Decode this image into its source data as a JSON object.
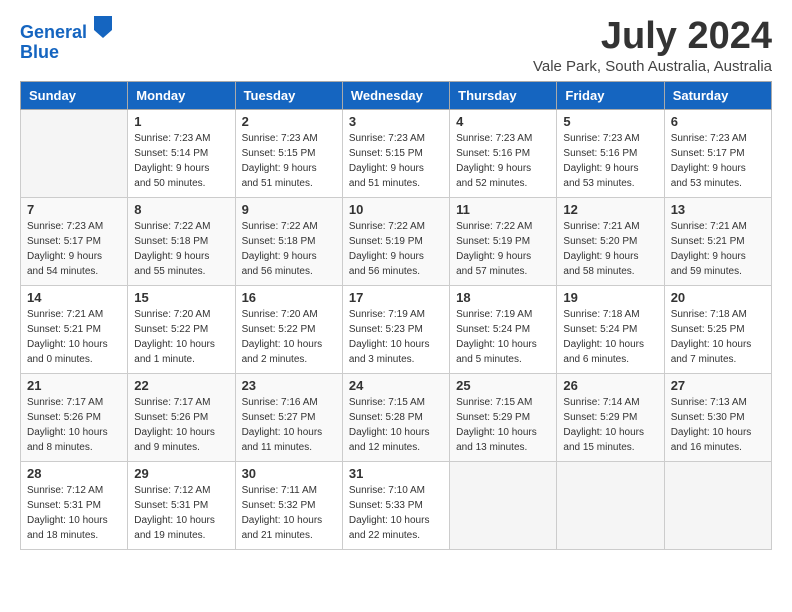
{
  "header": {
    "logo_line1": "General",
    "logo_line2": "Blue",
    "month_title": "July 2024",
    "location": "Vale Park, South Australia, Australia"
  },
  "days_of_week": [
    "Sunday",
    "Monday",
    "Tuesday",
    "Wednesday",
    "Thursday",
    "Friday",
    "Saturday"
  ],
  "weeks": [
    [
      {
        "date": "",
        "info": ""
      },
      {
        "date": "1",
        "info": "Sunrise: 7:23 AM\nSunset: 5:14 PM\nDaylight: 9 hours\nand 50 minutes."
      },
      {
        "date": "2",
        "info": "Sunrise: 7:23 AM\nSunset: 5:15 PM\nDaylight: 9 hours\nand 51 minutes."
      },
      {
        "date": "3",
        "info": "Sunrise: 7:23 AM\nSunset: 5:15 PM\nDaylight: 9 hours\nand 51 minutes."
      },
      {
        "date": "4",
        "info": "Sunrise: 7:23 AM\nSunset: 5:16 PM\nDaylight: 9 hours\nand 52 minutes."
      },
      {
        "date": "5",
        "info": "Sunrise: 7:23 AM\nSunset: 5:16 PM\nDaylight: 9 hours\nand 53 minutes."
      },
      {
        "date": "6",
        "info": "Sunrise: 7:23 AM\nSunset: 5:17 PM\nDaylight: 9 hours\nand 53 minutes."
      }
    ],
    [
      {
        "date": "7",
        "info": "Sunrise: 7:23 AM\nSunset: 5:17 PM\nDaylight: 9 hours\nand 54 minutes."
      },
      {
        "date": "8",
        "info": "Sunrise: 7:22 AM\nSunset: 5:18 PM\nDaylight: 9 hours\nand 55 minutes."
      },
      {
        "date": "9",
        "info": "Sunrise: 7:22 AM\nSunset: 5:18 PM\nDaylight: 9 hours\nand 56 minutes."
      },
      {
        "date": "10",
        "info": "Sunrise: 7:22 AM\nSunset: 5:19 PM\nDaylight: 9 hours\nand 56 minutes."
      },
      {
        "date": "11",
        "info": "Sunrise: 7:22 AM\nSunset: 5:19 PM\nDaylight: 9 hours\nand 57 minutes."
      },
      {
        "date": "12",
        "info": "Sunrise: 7:21 AM\nSunset: 5:20 PM\nDaylight: 9 hours\nand 58 minutes."
      },
      {
        "date": "13",
        "info": "Sunrise: 7:21 AM\nSunset: 5:21 PM\nDaylight: 9 hours\nand 59 minutes."
      }
    ],
    [
      {
        "date": "14",
        "info": "Sunrise: 7:21 AM\nSunset: 5:21 PM\nDaylight: 10 hours\nand 0 minutes."
      },
      {
        "date": "15",
        "info": "Sunrise: 7:20 AM\nSunset: 5:22 PM\nDaylight: 10 hours\nand 1 minute."
      },
      {
        "date": "16",
        "info": "Sunrise: 7:20 AM\nSunset: 5:22 PM\nDaylight: 10 hours\nand 2 minutes."
      },
      {
        "date": "17",
        "info": "Sunrise: 7:19 AM\nSunset: 5:23 PM\nDaylight: 10 hours\nand 3 minutes."
      },
      {
        "date": "18",
        "info": "Sunrise: 7:19 AM\nSunset: 5:24 PM\nDaylight: 10 hours\nand 5 minutes."
      },
      {
        "date": "19",
        "info": "Sunrise: 7:18 AM\nSunset: 5:24 PM\nDaylight: 10 hours\nand 6 minutes."
      },
      {
        "date": "20",
        "info": "Sunrise: 7:18 AM\nSunset: 5:25 PM\nDaylight: 10 hours\nand 7 minutes."
      }
    ],
    [
      {
        "date": "21",
        "info": "Sunrise: 7:17 AM\nSunset: 5:26 PM\nDaylight: 10 hours\nand 8 minutes."
      },
      {
        "date": "22",
        "info": "Sunrise: 7:17 AM\nSunset: 5:26 PM\nDaylight: 10 hours\nand 9 minutes."
      },
      {
        "date": "23",
        "info": "Sunrise: 7:16 AM\nSunset: 5:27 PM\nDaylight: 10 hours\nand 11 minutes."
      },
      {
        "date": "24",
        "info": "Sunrise: 7:15 AM\nSunset: 5:28 PM\nDaylight: 10 hours\nand 12 minutes."
      },
      {
        "date": "25",
        "info": "Sunrise: 7:15 AM\nSunset: 5:29 PM\nDaylight: 10 hours\nand 13 minutes."
      },
      {
        "date": "26",
        "info": "Sunrise: 7:14 AM\nSunset: 5:29 PM\nDaylight: 10 hours\nand 15 minutes."
      },
      {
        "date": "27",
        "info": "Sunrise: 7:13 AM\nSunset: 5:30 PM\nDaylight: 10 hours\nand 16 minutes."
      }
    ],
    [
      {
        "date": "28",
        "info": "Sunrise: 7:12 AM\nSunset: 5:31 PM\nDaylight: 10 hours\nand 18 minutes."
      },
      {
        "date": "29",
        "info": "Sunrise: 7:12 AM\nSunset: 5:31 PM\nDaylight: 10 hours\nand 19 minutes."
      },
      {
        "date": "30",
        "info": "Sunrise: 7:11 AM\nSunset: 5:32 PM\nDaylight: 10 hours\nand 21 minutes."
      },
      {
        "date": "31",
        "info": "Sunrise: 7:10 AM\nSunset: 5:33 PM\nDaylight: 10 hours\nand 22 minutes."
      },
      {
        "date": "",
        "info": ""
      },
      {
        "date": "",
        "info": ""
      },
      {
        "date": "",
        "info": ""
      }
    ]
  ]
}
